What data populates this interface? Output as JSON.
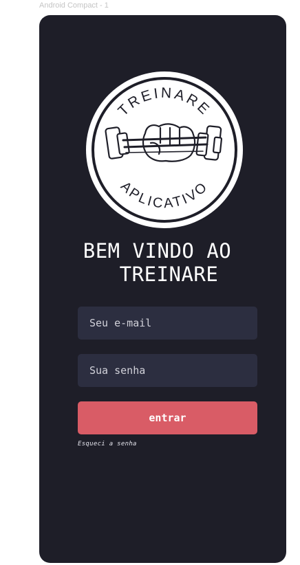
{
  "frame": {
    "label": "Android Compact - 1"
  },
  "logo": {
    "top_text": "TREINARE",
    "bottom_text": "APLICATIVO"
  },
  "welcome": {
    "line1": "BEM VINDO AO",
    "line2": "TREINARE"
  },
  "form": {
    "email_placeholder": "Seu e-mail",
    "password_placeholder": "Sua senha",
    "submit_label": "entrar",
    "forgot_label": "Esqueci a senha"
  },
  "colors": {
    "background": "#1e1e28",
    "input": "#2c2e40",
    "accent": "#d95c66",
    "text": "#ffffff"
  }
}
